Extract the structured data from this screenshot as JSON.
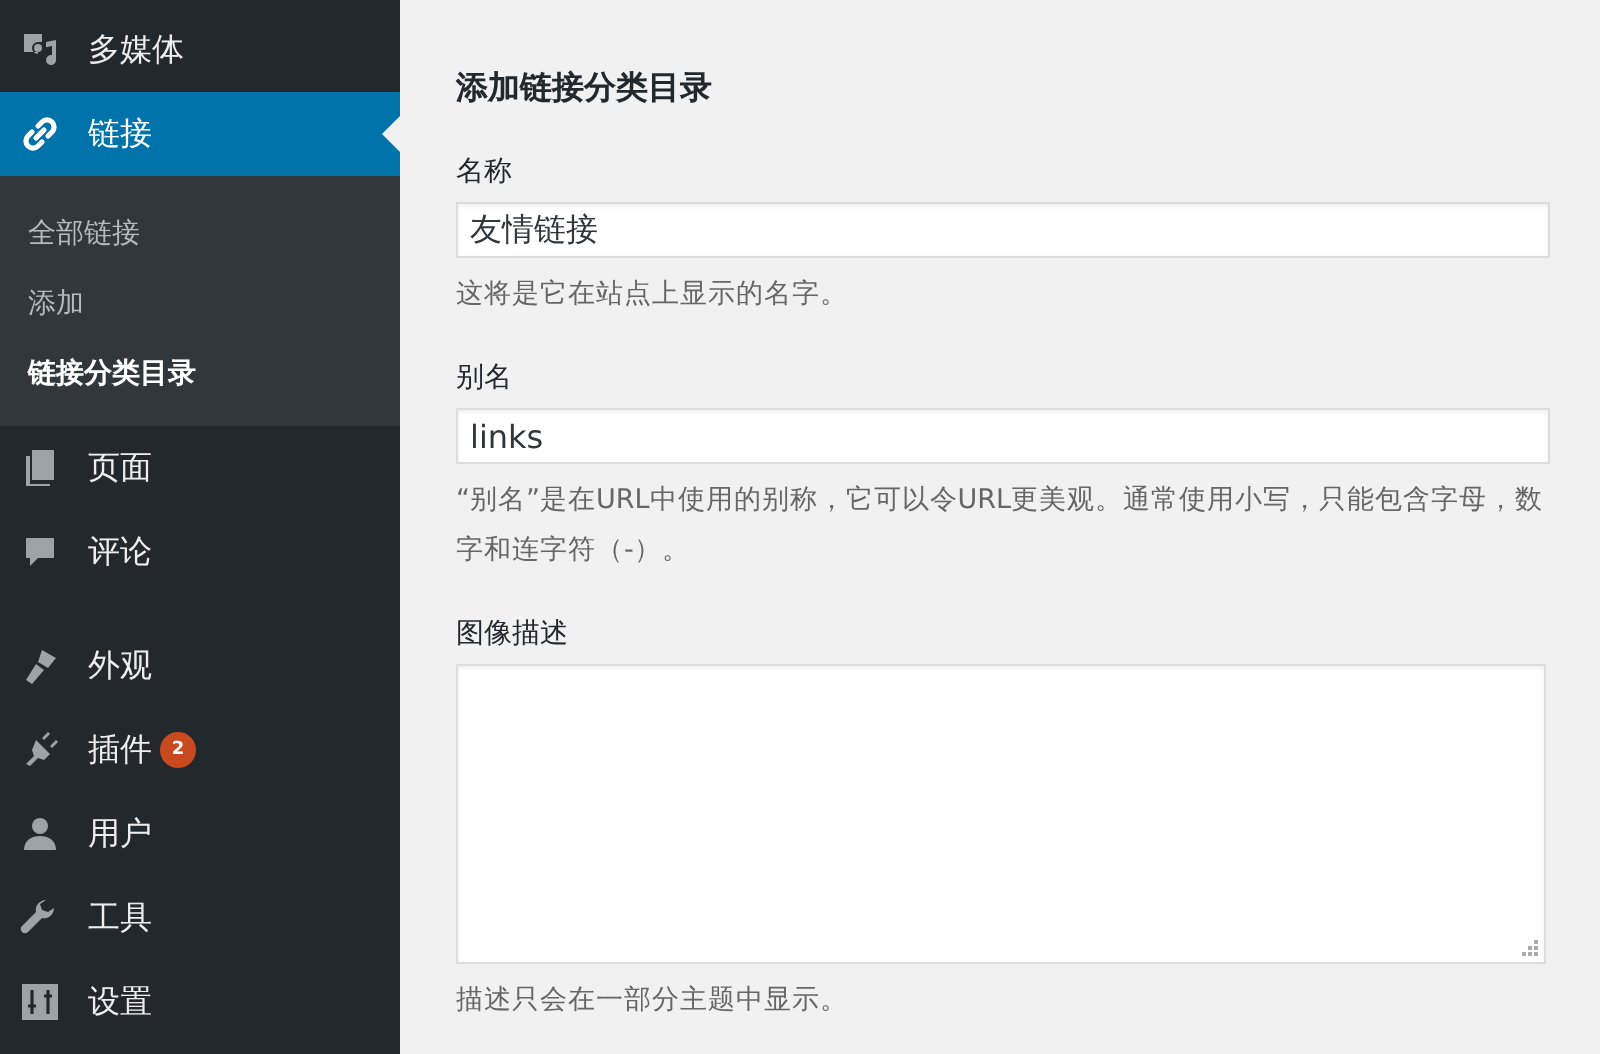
{
  "sidebar": {
    "items": [
      {
        "label": "多媒体",
        "selected": false
      },
      {
        "label": "链接",
        "selected": true,
        "children": [
          {
            "label": "全部链接",
            "selected": false
          },
          {
            "label": "添加",
            "selected": false
          },
          {
            "label": "链接分类目录",
            "selected": true
          }
        ]
      },
      {
        "label": "页面",
        "selected": false
      },
      {
        "label": "评论",
        "selected": false
      },
      {
        "label": "外观",
        "selected": false
      },
      {
        "label": "插件",
        "selected": false,
        "badge": "2"
      },
      {
        "label": "用户",
        "selected": false
      },
      {
        "label": "工具",
        "selected": false
      },
      {
        "label": "设置",
        "selected": false
      }
    ]
  },
  "form": {
    "title": "添加链接分类目录",
    "fields": [
      {
        "kind": "text",
        "label": "名称",
        "value": "友情链接",
        "hint": "这将是它在站点上显示的名字。"
      },
      {
        "kind": "text",
        "label": "别名",
        "value": "links",
        "hint": "“别名”是在URL中使用的别称，它可以令URL更美观。通常使用小写，只能包含字母，数字和连字符（-）。"
      },
      {
        "kind": "textarea",
        "label": "图像描述",
        "hint": "描述只会在一部分主题中显示。"
      }
    ]
  }
}
